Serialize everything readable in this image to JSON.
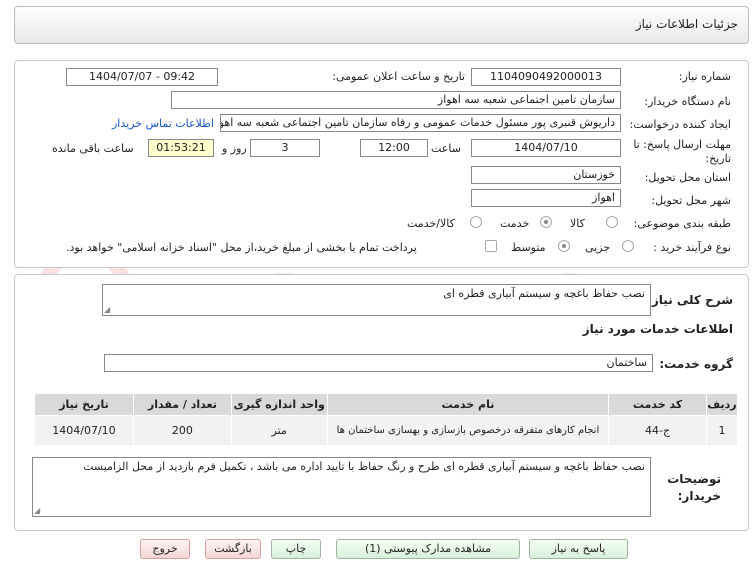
{
  "page_title": "جزئیات اطلاعات نیاز",
  "fields": {
    "need_number_label": "شماره نیاز:",
    "need_number": "1104090492000013",
    "announce_label": "تاریخ و ساعت اعلان عمومی:",
    "announce_value": "1404/07/07 - 09:42",
    "buyer_org_label": "نام دستگاه خریدار:",
    "buyer_org": "سازمان تامین اجتماعی شعبه سه اهواز",
    "creator_label": "ایجاد کننده درخواست:",
    "creator": "داریوش قنبری پور مسئول خدمات عمومی و رفاه سازمان تامین اجتماعی شعبه سه اهواز",
    "contact_link": "اطلاعات تماس خریدار",
    "deadline_label_1": "مهلت ارسال پاسخ: تا",
    "deadline_label_2": "تاریخ:",
    "deadline_date": "1404/07/10",
    "time_label": "ساعت",
    "deadline_time": "12:00",
    "days": "3",
    "days_label": "روز و",
    "remaining": "01:53:21",
    "remaining_label": "ساعت باقی مانده",
    "province_label": "استان محل تحویل:",
    "province": "خوزستان",
    "city_label": "شهر محل تحویل:",
    "city": "اهواز",
    "category_label": "طبقه بندی موضوعی:",
    "category_options": [
      "کالا",
      "خدمت",
      "کالا/خدمت"
    ],
    "category_selected": "خدمت",
    "process_label": "نوع فرآیند خرید :",
    "process_options": [
      "جزیی",
      "متوسط"
    ],
    "process_selected": "متوسط",
    "payment_note": "پرداخت تمام یا بخشی از مبلغ خرید،از محل \"اسناد خزانه اسلامی\" خواهد بود."
  },
  "summary": {
    "label": "شرح کلی نیاز:",
    "value": "نصب حفاظ باغچه و سیستم آبیاری قطره ای"
  },
  "services": {
    "section_title": "اطلاعات خدمات مورد نیاز",
    "group_label": "گروه خدمت:",
    "group_value": "ساختمان",
    "headers": [
      "ردیف",
      "کد خدمت",
      "نام خدمت",
      "واحد اندازه گیری",
      "تعداد / مقدار",
      "تاریخ نیاز"
    ],
    "rows": [
      [
        "1",
        "ج-44",
        "انجام کارهای متفرقه درخصوص بازسازی و بهسازی ساختمان ها",
        "متر",
        "200",
        "1404/07/10"
      ]
    ]
  },
  "buyer_notes": {
    "label_1": "توضیحات",
    "label_2": "خریدار:",
    "value": "نصب حفاظ باغچه و سیستم آبیاری قطره ای طرح و رنگ حفاظ با تایید اداره می باشد ، تکمیل فرم بازدید از محل الزامیست"
  },
  "buttons": {
    "reply": "پاسخ به نیاز",
    "attachments": "مشاهده مدارک پیوستی (1)",
    "print": "چاپ",
    "back": "بازگشت",
    "exit": "خروج"
  },
  "watermark": "AriaTender.neT",
  "colors": {
    "link": "#1a56c8",
    "timer_bg": "#ffffcc",
    "button_green": "#d8f0d8",
    "button_red": "#f5d6d6"
  }
}
